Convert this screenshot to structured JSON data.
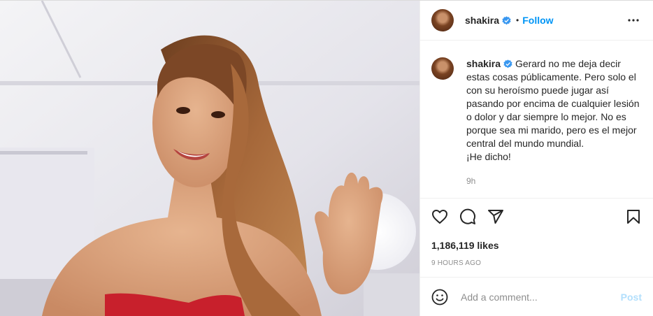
{
  "post": {
    "author": "shakira",
    "follow_label": "Follow",
    "dot": "•",
    "caption_text": "Gerard no me deja decir estas cosas públicamente. Pero solo el con su heroísmo puede jugar así pasando por encima de cualquier lesión o dolor y dar siempre lo mejor. No es porque sea mi marido, pero es el mejor central del mundo mundial.\n¡He dicho!",
    "caption_time": "9h",
    "likes": "1,186,119 likes",
    "age": "9 HOURS AGO"
  },
  "comment_box": {
    "placeholder": "Add a comment...",
    "post_label": "Post"
  },
  "colors": {
    "accent": "#0095f6",
    "post_disabled": "#b2dffc",
    "verified": "#3897f0",
    "dress": "#c8202c"
  },
  "icons": [
    "verified-badge-icon",
    "more-options-icon",
    "heart-icon",
    "comment-icon",
    "share-icon",
    "bookmark-icon",
    "emoji-icon"
  ]
}
